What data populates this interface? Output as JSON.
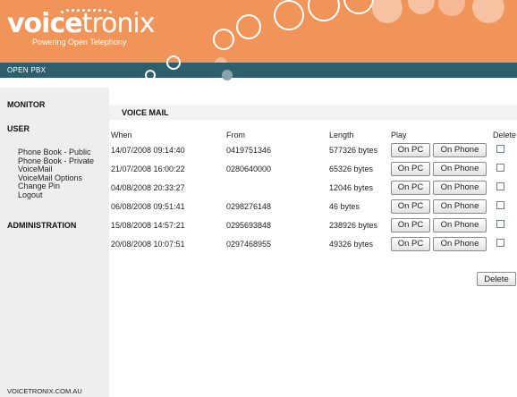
{
  "brand": {
    "logo_bold": "voice",
    "logo_light": "tronix",
    "tagline": "Powering Open Telephony",
    "product": "OPEN PBX",
    "footer": "VOICETRONIX.COM.AU",
    "header_color": "#f0945a",
    "bar_color": "#2d5f6c"
  },
  "sidebar": {
    "monitor": "MONITOR",
    "user": "USER",
    "items": [
      {
        "label": "Phone Book - Public"
      },
      {
        "label": "Phone Book - Private"
      },
      {
        "label": "VoiceMail"
      },
      {
        "label": "VoiceMail Options"
      },
      {
        "label": "Change Pin"
      },
      {
        "label": "Logout"
      }
    ],
    "administration": "ADMINISTRATION"
  },
  "main": {
    "title": "VOICE MAIL",
    "columns": {
      "when": "When",
      "from": "From",
      "length": "Length",
      "play": "Play",
      "delete": "Delete"
    },
    "play_pc_label": "On PC",
    "play_phone_label": "On Phone",
    "delete_button": "Delete",
    "rows": [
      {
        "when": "14/07/2008 09:14:40",
        "from": "0419751346",
        "length": "577326 bytes"
      },
      {
        "when": "21/07/2008 16:00:22",
        "from": "0280640000",
        "length": "65326 bytes"
      },
      {
        "when": "04/08/2008 20:33:27",
        "from": "",
        "length": "12046 bytes"
      },
      {
        "when": "06/08/2008 09:51:41",
        "from": "0298276148",
        "length": "46 bytes"
      },
      {
        "when": "15/08/2008 14:57:21",
        "from": "0295693848",
        "length": "238926 bytes"
      },
      {
        "when": "20/08/2008 10:07:51",
        "from": "0297468955",
        "length": "49326 bytes"
      }
    ]
  }
}
